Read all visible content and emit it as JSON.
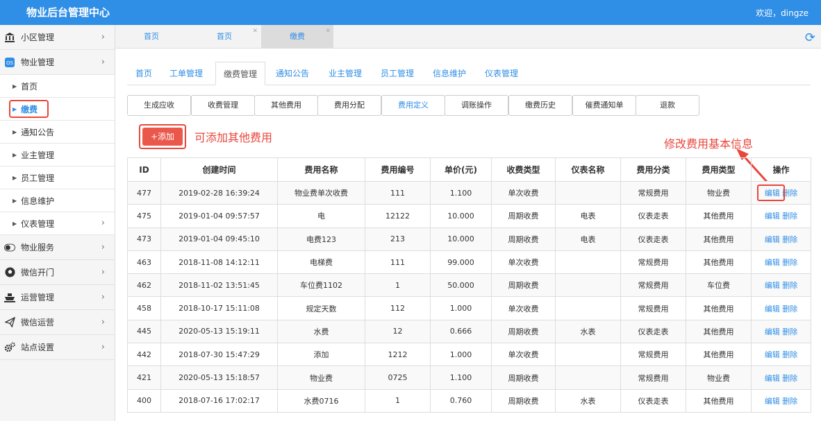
{
  "header": {
    "title": "物业后台管理中心",
    "welcome": "欢迎，dingze"
  },
  "sidebar": {
    "top_items": [
      {
        "label": "小区管理",
        "icon": "bank-icon"
      },
      {
        "label": "物业管理",
        "icon": "os-icon"
      }
    ],
    "sub_items": [
      "首页",
      "缴费",
      "通知公告",
      "业主管理",
      "员工管理",
      "信息维护",
      "仪表管理"
    ],
    "bottom_items": [
      {
        "label": "物业服务",
        "icon": "toggle-icon"
      },
      {
        "label": "微信开门",
        "icon": "soccer-icon"
      },
      {
        "label": "运营管理",
        "icon": "ship-icon"
      },
      {
        "label": "微信运营",
        "icon": "send-icon"
      },
      {
        "label": "站点设置",
        "icon": "gears-icon"
      }
    ]
  },
  "page_tabs": [
    "首页",
    "首页",
    "缴费"
  ],
  "module_tabs": [
    "首页",
    "工单管理",
    "缴费管理",
    "通知公告",
    "业主管理",
    "员工管理",
    "信息维护",
    "仪表管理"
  ],
  "sub_buttons": [
    "生成应收",
    "收费管理",
    "其他费用",
    "费用分配",
    "费用定义",
    "调账操作",
    "缴费历史",
    "催费通知单",
    "退款"
  ],
  "add_button": "+添加",
  "annotations": {
    "add_note": "可添加其他费用",
    "edit_note": "修改费用基本信息"
  },
  "table": {
    "headers": [
      "ID",
      "创建时间",
      "费用名称",
      "费用编号",
      "单价(元)",
      "收费类型",
      "仪表名称",
      "费用分类",
      "费用类型",
      "操作"
    ],
    "actions": {
      "edit": "编辑",
      "delete": "删除"
    },
    "rows": [
      [
        "477",
        "2019-02-28 16:39:24",
        "物业费单次收费",
        "111",
        "1.100",
        "单次收费",
        "",
        "常规费用",
        "物业费"
      ],
      [
        "475",
        "2019-01-04 09:57:57",
        "电",
        "12122",
        "10.000",
        "周期收费",
        "电表",
        "仪表走表",
        "其他费用"
      ],
      [
        "473",
        "2019-01-04 09:45:10",
        "电费123",
        "213",
        "10.000",
        "周期收费",
        "电表",
        "仪表走表",
        "其他费用"
      ],
      [
        "463",
        "2018-11-08 14:12:11",
        "电梯费",
        "111",
        "99.000",
        "单次收费",
        "",
        "常规费用",
        "其他费用"
      ],
      [
        "462",
        "2018-11-02 13:51:45",
        "车位费1102",
        "1",
        "50.000",
        "周期收费",
        "",
        "常规费用",
        "车位费"
      ],
      [
        "458",
        "2018-10-17 15:11:08",
        "规定天数",
        "112",
        "1.000",
        "单次收费",
        "",
        "常规费用",
        "其他费用"
      ],
      [
        "445",
        "2020-05-13 15:19:11",
        "水费",
        "12",
        "0.666",
        "周期收费",
        "水表",
        "仪表走表",
        "其他费用"
      ],
      [
        "442",
        "2018-07-30 15:47:29",
        "添加",
        "1212",
        "1.000",
        "单次收费",
        "",
        "常规费用",
        "其他费用"
      ],
      [
        "421",
        "2020-05-13 15:18:57",
        "物业费",
        "0725",
        "1.100",
        "周期收费",
        "",
        "常规费用",
        "物业费"
      ],
      [
        "400",
        "2018-07-16 17:02:17",
        "水费0716",
        "1",
        "0.760",
        "周期收费",
        "水表",
        "仪表走表",
        "其他费用"
      ]
    ]
  },
  "colors": {
    "brand": "#2f8ee5",
    "highlight": "#e8463b",
    "add_button": "#e9584b"
  }
}
